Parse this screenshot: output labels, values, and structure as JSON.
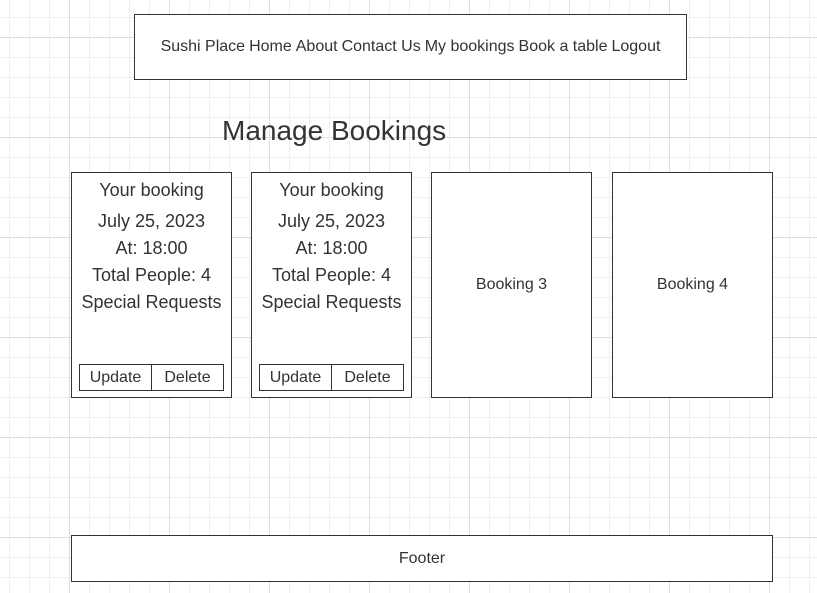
{
  "nav": {
    "items": [
      "Sushi Place",
      "Home",
      "About",
      "Contact Us",
      "My bookings",
      "Book a table",
      "Logout"
    ]
  },
  "page_title": "Manage Bookings",
  "bookings": [
    {
      "heading": "Your booking",
      "date": "July 25, 2023",
      "time": "At: 18:00",
      "people": "Total People: 4",
      "requests": "Special Requests",
      "update_label": "Update",
      "delete_label": "Delete"
    },
    {
      "heading": "Your booking",
      "date": "July 25, 2023",
      "time": "At: 18:00",
      "people": "Total People: 4",
      "requests": "Special Requests",
      "update_label": "Update",
      "delete_label": "Delete"
    }
  ],
  "placeholders": [
    "Booking 3",
    "Booking 4"
  ],
  "footer": "Footer"
}
